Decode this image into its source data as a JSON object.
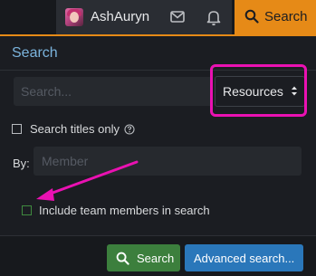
{
  "topbar": {
    "username": "AshAuryn",
    "search_tab_label": "Search"
  },
  "panel": {
    "title": "Search",
    "query_placeholder": "Search...",
    "content_type_value": "Resources",
    "titles_only_label": "Search titles only",
    "by_label": "By:",
    "member_placeholder": "Member",
    "include_team_label": "Include team members in search"
  },
  "footer": {
    "search_button_label": "Search",
    "advanced_search_label": "Advanced search..."
  },
  "colors": {
    "accent": "#e68a17",
    "panel_title": "#7bb4dd",
    "annotation": "#ea11b2",
    "search_button": "#3c7f3d",
    "advanced_button": "#2a77ba"
  },
  "icons": [
    "avatar",
    "mail-icon",
    "bell-icon",
    "search-icon",
    "question-circle-icon",
    "chevron-updown-icon"
  ]
}
